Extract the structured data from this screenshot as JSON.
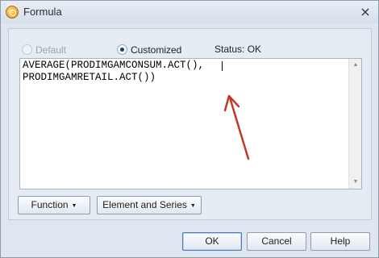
{
  "window": {
    "title": "Formula",
    "close_glyph": "×",
    "icon": "formula-app-icon"
  },
  "mode": {
    "options": [
      {
        "label": "Default",
        "selected": false,
        "enabled": false
      },
      {
        "label": "Customized",
        "selected": true,
        "enabled": true
      }
    ]
  },
  "status": {
    "label": "Status:",
    "value": "OK"
  },
  "editor": {
    "text": "AVERAGE(PRODIMGAMCONSUM.ACT(),\nPRODIMGAMRETAIL.ACT())",
    "annotation": {
      "kind": "arrow",
      "color": "#c0392b"
    }
  },
  "tools": {
    "function_label": "Function",
    "element_series_label": "Element and Series",
    "dropdown_glyph": "▼"
  },
  "footer": {
    "ok_label": "OK",
    "cancel_label": "Cancel",
    "help_label": "Help"
  },
  "colors": {
    "frame": "#dfe6ef",
    "panel": "#e6ecf4",
    "arrow": "#c0392b"
  }
}
